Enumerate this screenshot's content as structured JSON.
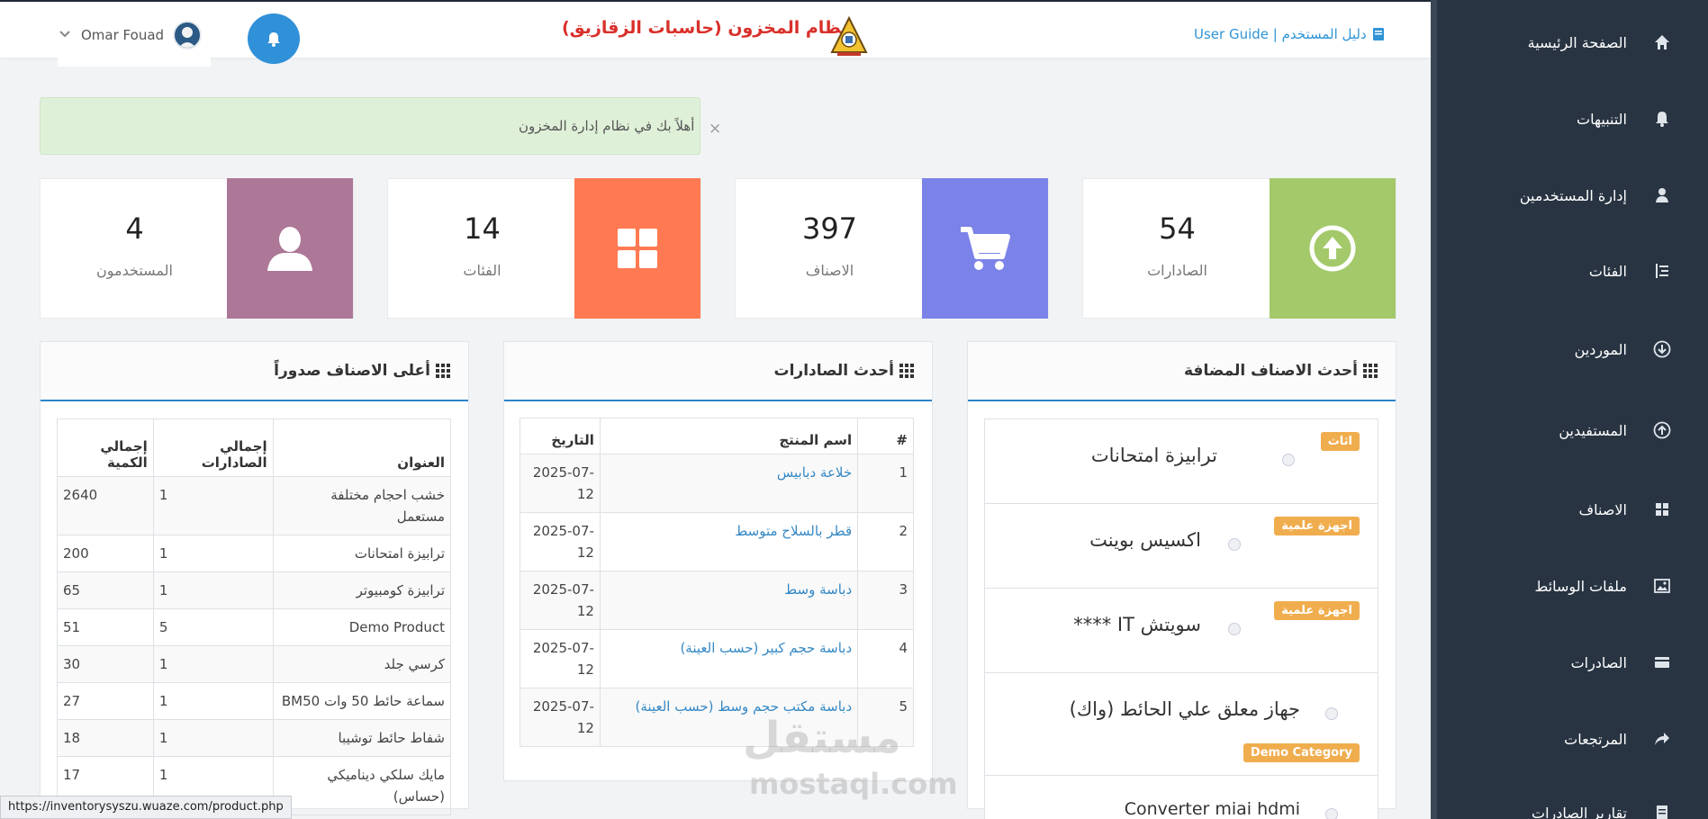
{
  "header": {
    "user_name": "Omar Fouad",
    "system_title": "نظام المخزون (حاسبات الزقازيق)",
    "user_guide": "User Guide | دليل المستخدم"
  },
  "alert": {
    "message": "أهلاً بك في نظام إدارة المخزون",
    "close": "×"
  },
  "stats": [
    {
      "value": "54",
      "label": "الصادارات",
      "color": "#a4c96a",
      "icon": "arrow-up-circle-icon"
    },
    {
      "value": "397",
      "label": "الاصناف",
      "color": "#7b83e8",
      "icon": "cart-icon"
    },
    {
      "value": "14",
      "label": "الفئات",
      "color": "#ff7a52",
      "icon": "grid-icon"
    },
    {
      "value": "4",
      "label": "المستخدمون",
      "color": "#ad7797",
      "icon": "user-icon"
    }
  ],
  "sidebar": {
    "items": [
      {
        "label": "الصفحة الرئيسية",
        "icon": "home-icon"
      },
      {
        "label": "التنبيهات",
        "icon": "bell-icon"
      },
      {
        "label": "إدارة المستخدمين",
        "icon": "user-icon"
      },
      {
        "label": "الفئات",
        "icon": "list-indent-icon"
      },
      {
        "label": "الموردين",
        "icon": "arrow-down-circle-icon"
      },
      {
        "label": "المستفيدين",
        "icon": "arrow-up-circle-icon"
      },
      {
        "label": "الاصناف",
        "icon": "grid-icon"
      },
      {
        "label": "ملفات الوسائط",
        "icon": "image-icon"
      },
      {
        "label": "الصادرات",
        "icon": "card-icon"
      },
      {
        "label": "المرتجعات",
        "icon": "share-icon"
      },
      {
        "label": "تقارير الصادرات",
        "icon": "report-icon"
      }
    ]
  },
  "top_items": {
    "title": "أعلى الاصناف صدوراً",
    "headers": [
      "العنوان",
      "إجمالي الصادارات",
      "إجمالي الكمية"
    ],
    "rows": [
      [
        "خشب احجام مختلفة مستعمل",
        "1",
        "2640"
      ],
      [
        "ترابيزة امتحانات",
        "1",
        "200"
      ],
      [
        "ترابيزة كومبيوتر",
        "1",
        "65"
      ],
      [
        "Demo Product",
        "5",
        "51"
      ],
      [
        "كرسي جلد",
        "1",
        "30"
      ],
      [
        "سماعة حائط 50 وات BM50",
        "1",
        "27"
      ],
      [
        "شفاط حائط توشيبا",
        "1",
        "18"
      ],
      [
        "مايك سلكي ديناميكي (حساس)",
        "1",
        "17"
      ]
    ]
  },
  "latest_exports": {
    "title": "أحدث الصادارات",
    "headers": [
      "#",
      "اسم المنتج",
      "التاريخ"
    ],
    "rows": [
      [
        "1",
        "خلاعة دبابيس",
        "2025-07-12"
      ],
      [
        "2",
        "قطر بالسلاح متوسط",
        "2025-07-12"
      ],
      [
        "3",
        "دباسة وسط",
        "2025-07-12"
      ],
      [
        "4",
        "دباسة حجم كبير (حسب العينة)",
        "2025-07-12"
      ],
      [
        "5",
        "دباسة مكتب حجم وسط (حسب العينة)",
        "2025-07-12"
      ]
    ]
  },
  "latest_added": {
    "title": "أحدث الاصناف المضافة",
    "items": [
      {
        "name": "ترابيزة امتحانات",
        "badge": "اثاث"
      },
      {
        "name": "اكسيس بوينت",
        "badge": "اجهزة علمية"
      },
      {
        "name": "سويتش IT ****",
        "badge": "اجهزة علمية"
      },
      {
        "name": "جهاز معلق علي الحائط (واك)",
        "badge": "Demo Category"
      },
      {
        "name": "Converter miai hdmi",
        "badge": ""
      }
    ]
  },
  "statusbar": {
    "url": "https://inventorysyszu.wuaze.com/product.php"
  },
  "watermark": {
    "text": "مستقل",
    "domain": "mostaql.com"
  }
}
